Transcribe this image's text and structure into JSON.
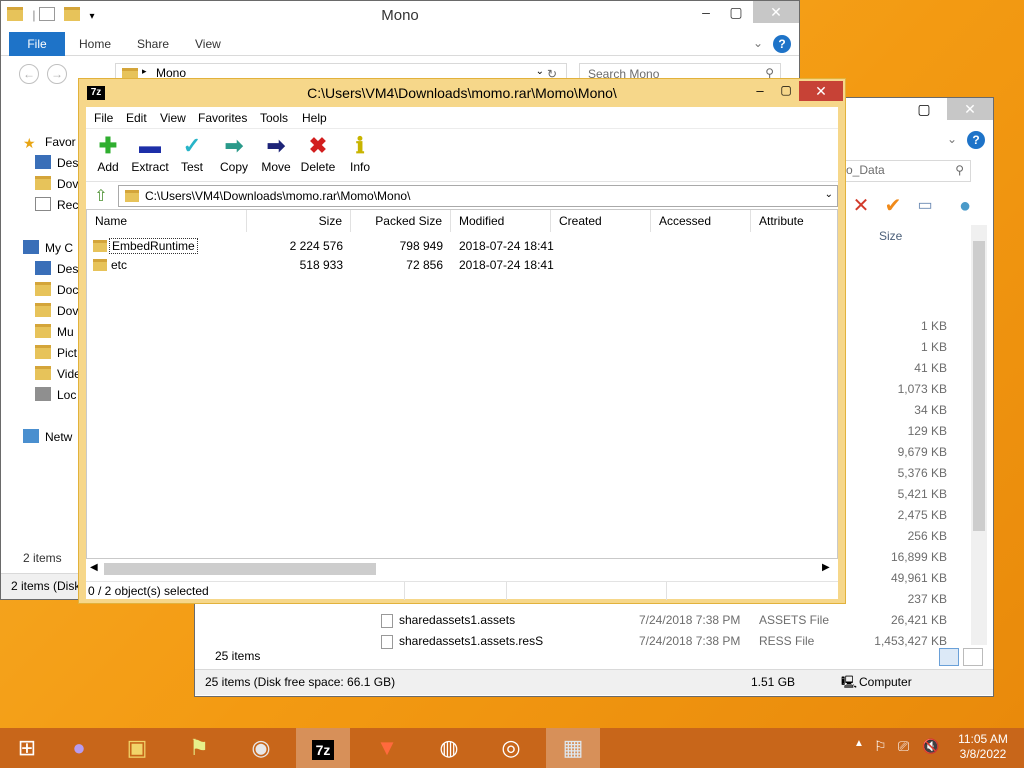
{
  "explorer_main": {
    "title": "Mono",
    "tabs": [
      "File",
      "Home",
      "Share",
      "View"
    ],
    "address": "Mono",
    "search_placeholder": "Search Mono",
    "sidebar": [
      "Favor",
      "Des",
      "Dov",
      "Rec",
      "My C",
      "Des",
      "Doc",
      "Dov",
      "Mu",
      "Pict",
      "Vide",
      "Loc",
      "Netw"
    ],
    "items_count": "2 items",
    "status": "2 items (Disk"
  },
  "explorer_back": {
    "search_value": "o_Data",
    "size_header": "Size",
    "sizes": [
      "1 KB",
      "1 KB",
      "41 KB",
      "1,073 KB",
      "34 KB",
      "129 KB",
      "9,679 KB",
      "5,376 KB",
      "5,421 KB",
      "2,475 KB",
      "256 KB",
      "16,899 KB",
      "49,961 KB",
      "237 KB"
    ],
    "files": [
      {
        "name": "sharedassets1.assets",
        "date": "7/24/2018 7:38 PM",
        "type": "ASSETS File",
        "size": "26,421 KB"
      },
      {
        "name": "sharedassets1.assets.resS",
        "date": "7/24/2018 7:38 PM",
        "type": "RESS File",
        "size": "1,453,427 KB"
      }
    ],
    "items_count": "25 items",
    "status_left": "25 items (Disk free space: 66.1 GB)",
    "status_size": "1.51 GB",
    "status_computer": "Computer"
  },
  "sevenzip": {
    "title": "C:\\Users\\VM4\\Downloads\\momo.rar\\Momo\\Mono\\",
    "logo": "7z",
    "menu": [
      "File",
      "Edit",
      "View",
      "Favorites",
      "Tools",
      "Help"
    ],
    "toolbar": [
      "Add",
      "Extract",
      "Test",
      "Copy",
      "Move",
      "Delete",
      "Info"
    ],
    "address": "C:\\Users\\VM4\\Downloads\\momo.rar\\Momo\\Mono\\",
    "columns": [
      "Name",
      "Size",
      "Packed Size",
      "Modified",
      "Created",
      "Accessed",
      "Attribute"
    ],
    "rows": [
      {
        "name": "EmbedRuntime",
        "size": "2 224 576",
        "packed": "798 949",
        "modified": "2018-07-24 18:41"
      },
      {
        "name": "etc",
        "size": "518 933",
        "packed": "72 856",
        "modified": "2018-07-24 18:41"
      }
    ],
    "status": "0 / 2 object(s) selected"
  },
  "taskbar": {
    "time": "11:05 AM",
    "date": "3/8/2022"
  },
  "colors": {
    "accent_blue": "#1e73c8",
    "sevenzip_frame": "#f6d78a",
    "close_red": "#c74236",
    "taskbar": "#c8661a"
  }
}
